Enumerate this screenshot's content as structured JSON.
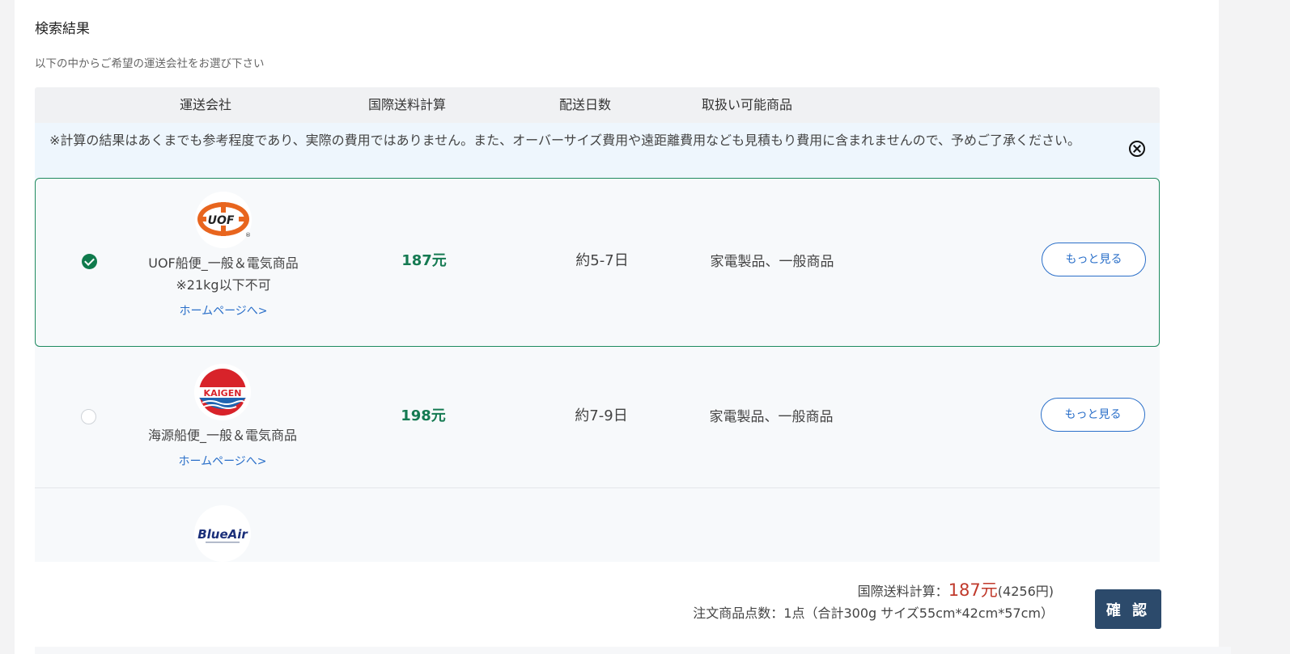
{
  "header": {
    "title": "検索結果",
    "subtitle": "以下の中からご希望の運送会社をお選び下さい"
  },
  "table": {
    "columns": [
      "運送会社",
      "国際送料計算",
      "配送日数",
      "取扱い可能商品"
    ],
    "notice": "※計算の結果はあくまでも参考程度であり、実際の費用ではありません。また、オーバーサイズ費用や遠距離費用なども見積もり費用に含まれませんので、予めご了承ください。",
    "rows": [
      {
        "selected": true,
        "logo_text": "UOF",
        "name_line1": "UOF船便_一般＆電気商品",
        "name_line2": "※21kg以下不可",
        "homepage_link": "ホームページへ>",
        "price": "187元",
        "days": "約5-7日",
        "goods": "家電製品、一般商品",
        "more_label": "もっと見る"
      },
      {
        "selected": false,
        "logo_text": "KAIGEN",
        "name_line1": "海源船便_一般＆電気商品",
        "homepage_link": "ホームページへ>",
        "price": "198元",
        "days": "約7-9日",
        "goods": "家電製品、一般商品",
        "more_label": "もっと見る"
      },
      {
        "selected": false,
        "logo_text": "BlueAir"
      }
    ]
  },
  "summary": {
    "label": "国際送料計算：",
    "price": "187元",
    "yen": "(4256円)",
    "order_info": "注文商品点数：1点（合計300g サイズ55cm*42cm*57cm）"
  },
  "confirm_label": "確 認",
  "colors": {
    "selected_border": "#1e8a5f",
    "price_green": "#157a52",
    "link_blue": "#2a6fc9",
    "summary_red": "#c0392b",
    "confirm_bg": "#2c4a6b"
  }
}
